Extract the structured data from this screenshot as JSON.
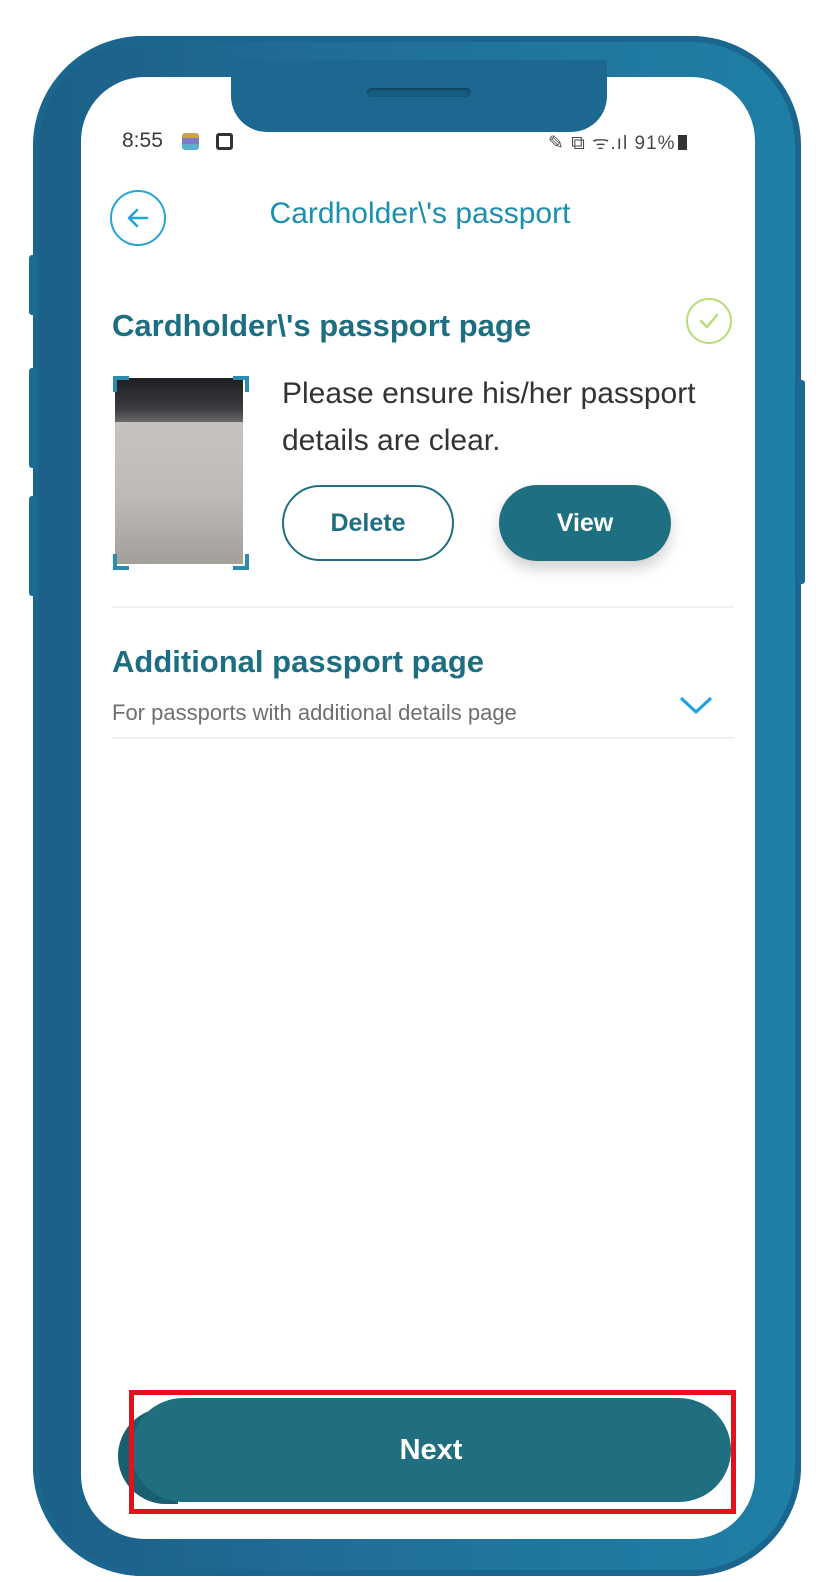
{
  "status_bar": {
    "time": "8:55",
    "right_indicators": "91%"
  },
  "header": {
    "title": "Cardholder\\'s passport"
  },
  "passport_page": {
    "title": "Cardholder\\'s passport page",
    "description": "Please ensure his/her passport details are clear.",
    "delete_label": "Delete",
    "view_label": "View"
  },
  "additional_page": {
    "title": "Additional passport page",
    "subtitle": "For passports with additional details page"
  },
  "footer": {
    "next_label": "Next"
  },
  "colors": {
    "frame": "#1f6f9a",
    "primary_button": "#1f6f82",
    "title_text": "#1c8fae",
    "back_icon": "#25a5d6",
    "check_icon": "#b7dd78",
    "highlight": "#e1121b"
  },
  "icons": [
    "back-arrow-icon",
    "check-circle-icon",
    "chevron-down-icon",
    "battery-icon",
    "wifi-icon",
    "signal-icon"
  ]
}
